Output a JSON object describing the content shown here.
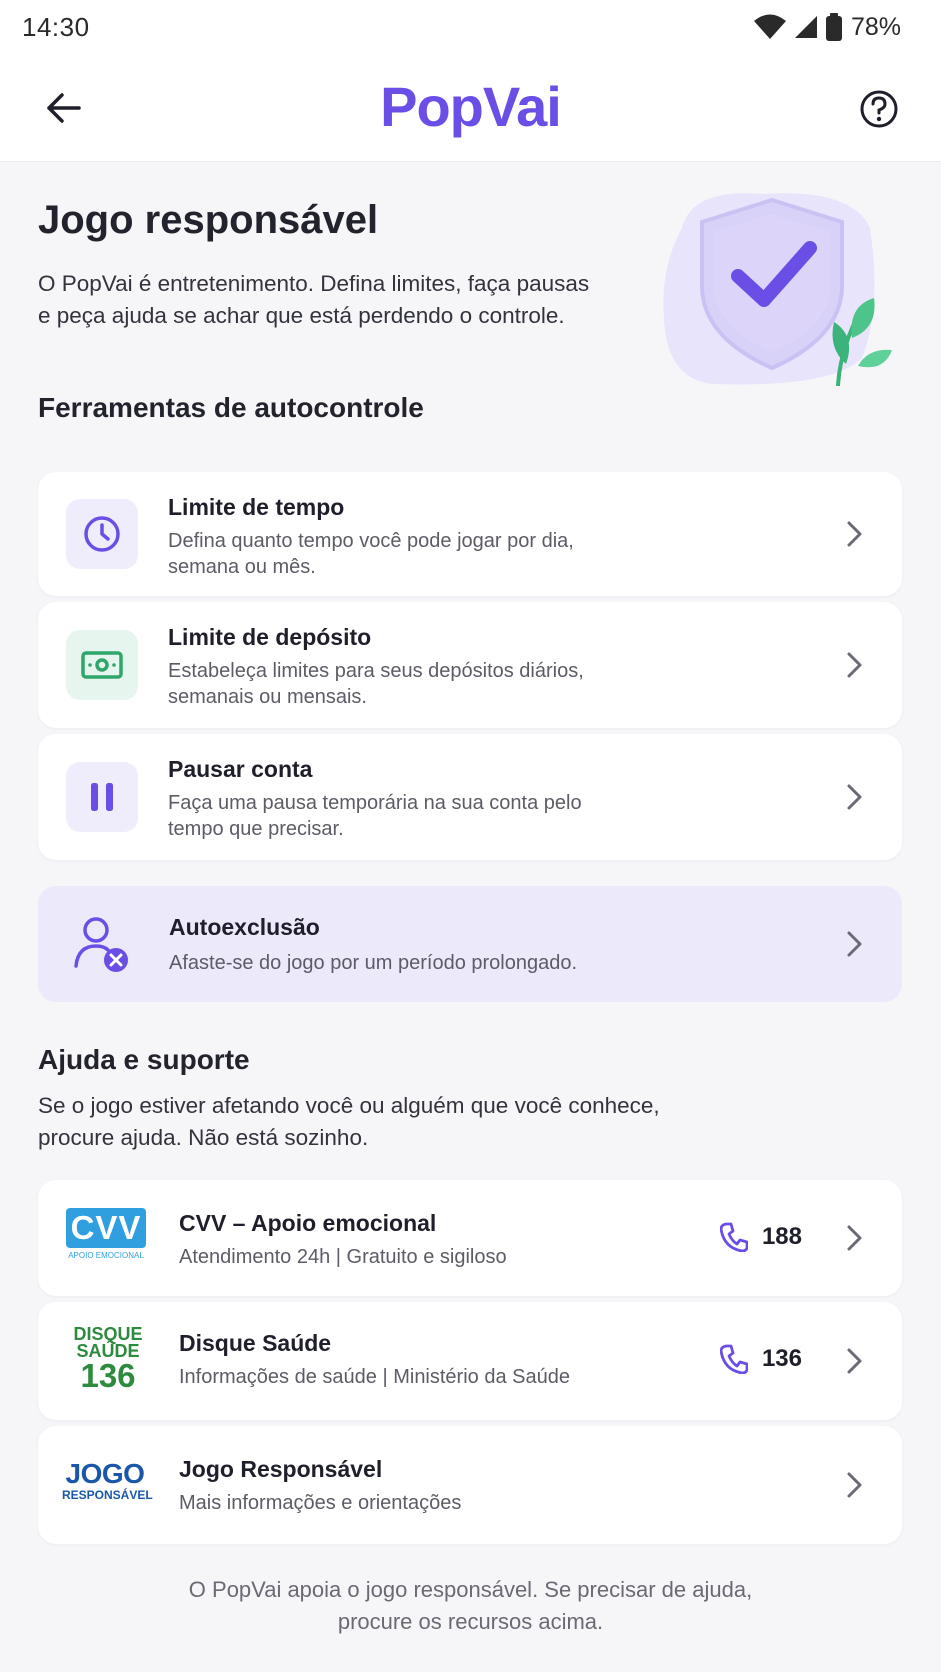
{
  "status": {
    "time": "14:30",
    "battery": "78%"
  },
  "header": {
    "logo": "PopVai"
  },
  "hero": {
    "title": "Jogo responsável",
    "description": "O PopVai é entretenimento. Defina limites, faça pausas e peça ajuda se achar que está perdendo o controle."
  },
  "tools": {
    "title": "Ferramentas de autocontrole",
    "items": [
      {
        "title": "Limite de tempo",
        "description": "Defina quanto tempo você pode jogar por dia, semana ou mês.",
        "icon": "clock-icon"
      },
      {
        "title": "Limite de depósito",
        "description": "Estabeleça limites para seus depósitos diários, semanais ou mensais.",
        "icon": "money-icon"
      },
      {
        "title": "Pausar conta",
        "description": "Faça uma pausa temporária na sua conta pelo tempo que precisar.",
        "icon": "pause-icon"
      }
    ],
    "exclusion": {
      "title": "Autoexclusão",
      "description": "Afaste-se do jogo por um período prolongado.",
      "icon": "user-block-icon"
    }
  },
  "help": {
    "title": "Ajuda e suporte",
    "description": "Se o jogo estiver afetando você ou alguém que você conhece, procure ajuda. Não está sozinho.",
    "items": [
      {
        "title": "CVV – Apoio emocional",
        "description": "Atendimento 24h | Gratuito e sigiloso",
        "phone": "188",
        "logo_main": "CVV",
        "logo_sub": "APOIO EMOCIONAL"
      },
      {
        "title": "Disque Saúde",
        "description": "Informações de saúde | Ministério da Saúde",
        "phone": "136",
        "logo_line1": "DISQUE",
        "logo_line2": "SAÚDE",
        "logo_line3": "136"
      },
      {
        "title": "Jogo Responsável",
        "description": "Mais informações e orientações",
        "logo_line1": "JOGO",
        "logo_line2": "RESPONSÁVEL"
      }
    ]
  },
  "footer": {
    "text": "O PopVai apoia o jogo responsável. Se precisar de ajuda, procure os recursos acima."
  },
  "colors": {
    "accent": "#6b4ee6",
    "background": "#f6f6f9",
    "exclusion_bg": "#ece9fb",
    "money_green": "#2fa66a"
  }
}
